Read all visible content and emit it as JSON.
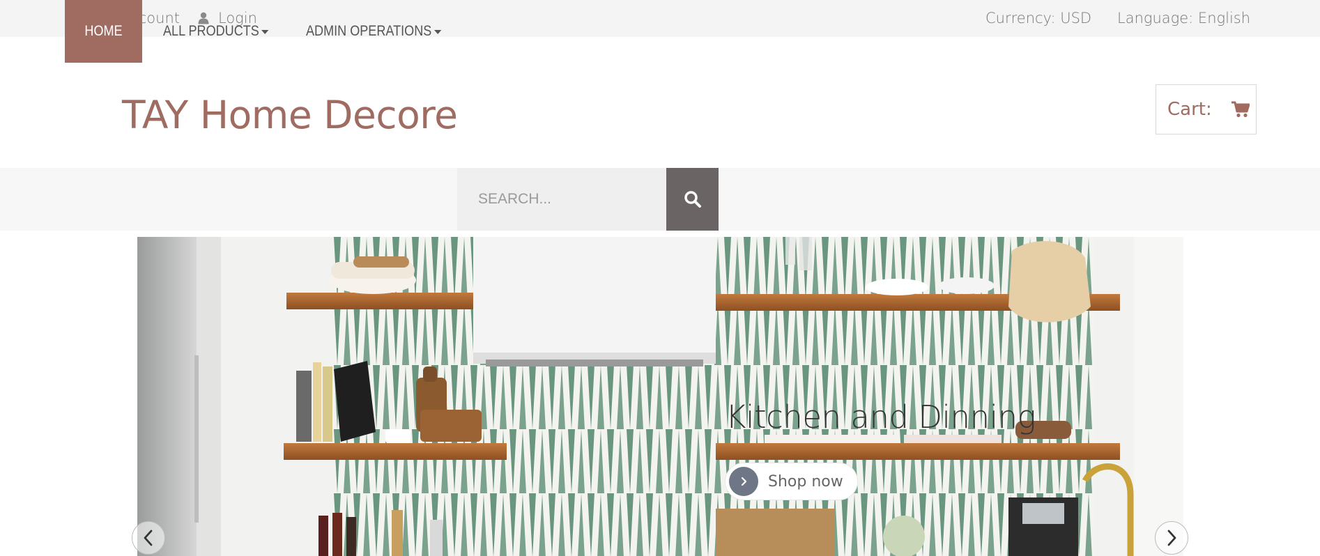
{
  "topbar": {
    "my_account": "My Account",
    "login": "Login",
    "currency": "Currency: USD",
    "language": "Language: English"
  },
  "header": {
    "logo": "TAY Home Decore",
    "cart_label": "Cart:"
  },
  "nav": {
    "home": "HOME",
    "all_products": "ALL PRODUCTS",
    "admin_operations": "ADMIN OPERATIONS",
    "search_placeholder": "SEARCH..."
  },
  "hero": {
    "slide_title": "Kitchen and Dinning",
    "shop_button": "Shop now"
  },
  "icons": {
    "user": "user-icon",
    "cart": "shopping-cart-icon",
    "search": "search-icon",
    "caret": "caret-down-icon",
    "prev": "chevron-left-icon",
    "next": "chevron-right-icon"
  },
  "colors": {
    "brand": "#a06c62",
    "topbar_bg": "#f4f4f4",
    "nav_bg": "#f7f7f7",
    "search_button": "#6a6464",
    "shop_circle": "#6f7786"
  }
}
